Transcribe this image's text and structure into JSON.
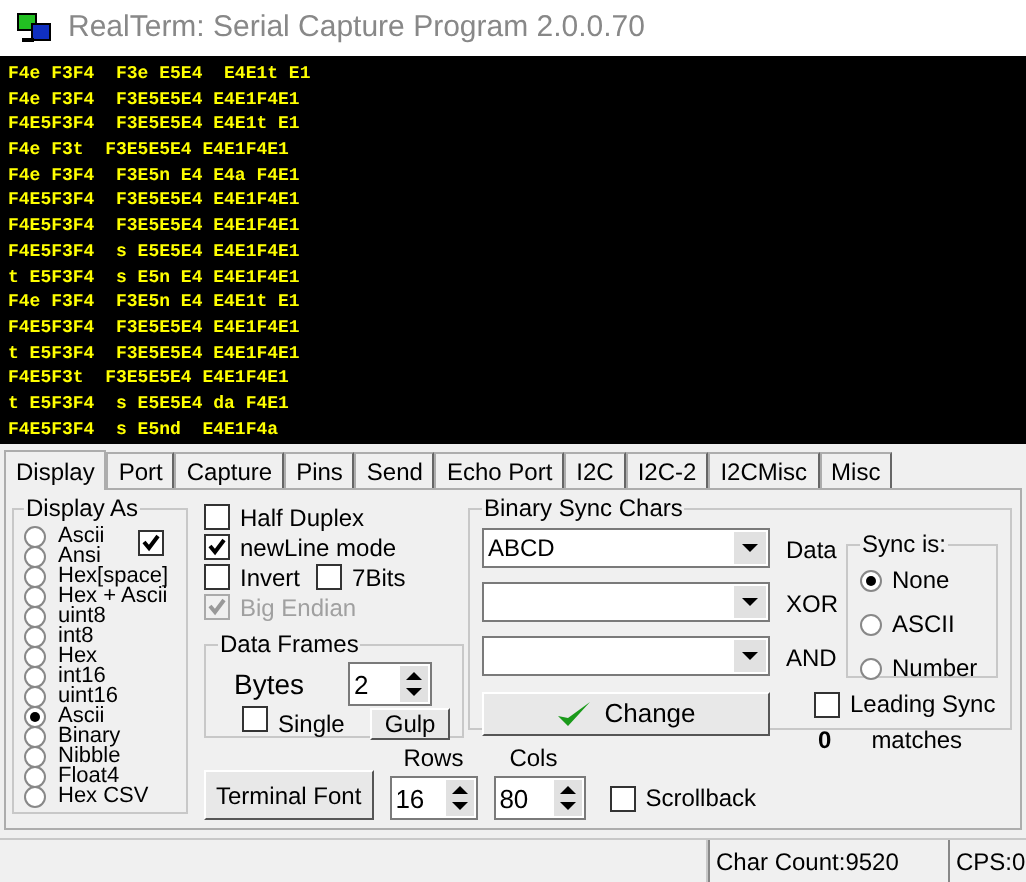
{
  "window": {
    "title": "RealTerm: Serial Capture Program 2.0.0.70"
  },
  "terminal": {
    "lines": [
      "F4e F3F4  F3e E5E4  E4E1t E1",
      "F4e F3F4  F3E5E5E4 E4E1F4E1",
      "F4E5F3F4  F3E5E5E4 E4E1t E1",
      "F4e F3t  F3E5E5E4 E4E1F4E1",
      "F4e F3F4  F3E5n E4 E4a F4E1",
      "F4E5F3F4  F3E5E5E4 E4E1F4E1",
      "F4E5F3F4  F3E5E5E4 E4E1F4E1",
      "F4E5F3F4  s E5E5E4 E4E1F4E1",
      "t E5F3F4  s E5n E4 E4E1F4E1",
      "F4e F3F4  F3E5n E4 E4E1t E1",
      "F4E5F3F4  F3E5E5E4 E4E1F4E1",
      "t E5F3F4  F3E5E5E4 E4E1F4E1",
      "F4E5F3t  F3E5E5E4 E4E1F4E1",
      "t E5F3F4  s E5E5E4 da F4E1",
      "F4E5F3F4  s E5nd  E4E1F4a"
    ]
  },
  "tabs": [
    {
      "label": "Display",
      "selected": true
    },
    {
      "label": "Port",
      "selected": false
    },
    {
      "label": "Capture",
      "selected": false
    },
    {
      "label": "Pins",
      "selected": false
    },
    {
      "label": "Send",
      "selected": false
    },
    {
      "label": "Echo Port",
      "selected": false
    },
    {
      "label": "I2C",
      "selected": false
    },
    {
      "label": "I2C-2",
      "selected": false
    },
    {
      "label": "I2CMisc",
      "selected": false
    },
    {
      "label": "Misc",
      "selected": false
    }
  ],
  "display_as": {
    "title": "Display As",
    "checked": true,
    "options": [
      {
        "label": "Ascii",
        "selected": false
      },
      {
        "label": "Ansi",
        "selected": false
      },
      {
        "label": "Hex[space]",
        "selected": false
      },
      {
        "label": "Hex + Ascii",
        "selected": false
      },
      {
        "label": "uint8",
        "selected": false
      },
      {
        "label": "int8",
        "selected": false
      },
      {
        "label": "Hex",
        "selected": false
      },
      {
        "label": "int16",
        "selected": false
      },
      {
        "label": "uint16",
        "selected": false
      },
      {
        "label": "Ascii",
        "selected": true
      },
      {
        "label": "Binary",
        "selected": false
      },
      {
        "label": "Nibble",
        "selected": false
      },
      {
        "label": "Float4",
        "selected": false
      },
      {
        "label": "Hex CSV",
        "selected": false
      }
    ]
  },
  "option_rows": [
    [
      {
        "label": "Half Duplex",
        "checked": false,
        "disabled": false
      }
    ],
    [
      {
        "label": "newLine mode",
        "checked": true,
        "disabled": false
      }
    ],
    [
      {
        "label": "Invert",
        "checked": false,
        "disabled": false
      },
      {
        "label": "7Bits",
        "checked": false,
        "disabled": false
      }
    ],
    [
      {
        "label": "Big Endian",
        "checked": true,
        "disabled": true
      }
    ]
  ],
  "data_frames": {
    "title": "Data Frames",
    "bytes_label": "Bytes",
    "bytes": "2",
    "single": {
      "label": "Single",
      "checked": false
    },
    "gulp": "Gulp"
  },
  "terminal_font": "Terminal Font",
  "rows": {
    "label": "Rows",
    "value": "16"
  },
  "cols": {
    "label": "Cols",
    "value": "80"
  },
  "scrollback": {
    "label": "Scrollback",
    "checked": false
  },
  "binary_sync": {
    "title": "Binary Sync Chars",
    "fields": [
      {
        "value": "ABCD",
        "label": "Data"
      },
      {
        "label": "XOR"
      },
      {
        "label": "AND"
      }
    ],
    "change": "Change",
    "sync_is": {
      "title": "Sync is:",
      "options": [
        {
          "label": "None",
          "selected": true
        },
        {
          "label": "ASCII",
          "selected": false
        },
        {
          "label": "Number",
          "selected": false
        }
      ]
    },
    "leading_sync": {
      "label": "Leading Sync",
      "checked": false
    },
    "count": "0",
    "matches": "matches"
  },
  "status_bar": [
    "Char Count:9520",
    "CPS:0"
  ]
}
